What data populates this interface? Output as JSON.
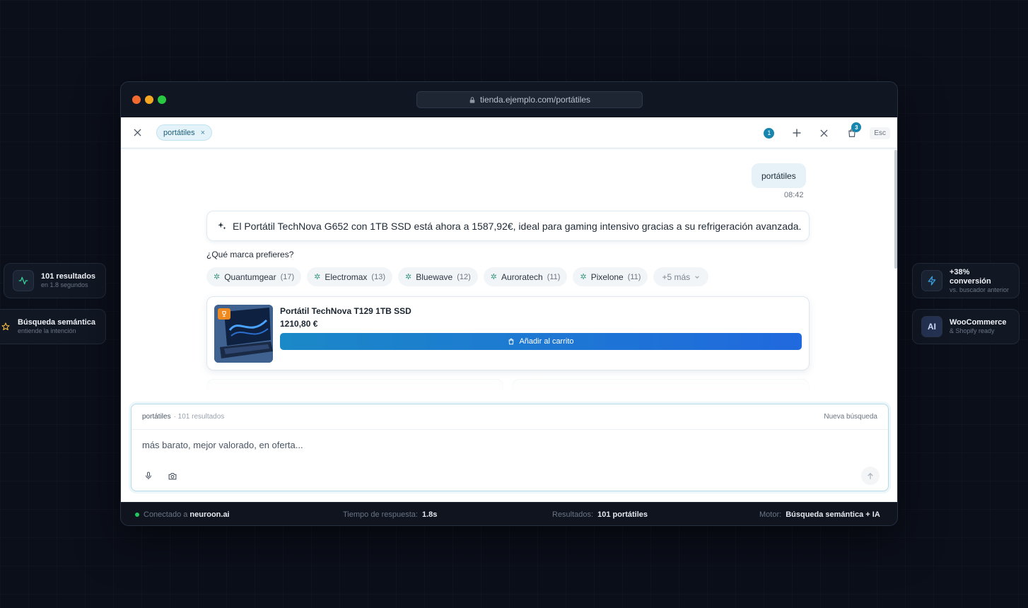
{
  "browser": {
    "url": "tienda.ejemplo.com/portátiles",
    "dot_colors": [
      "#f26a2e",
      "#f5a623",
      "#28c840"
    ]
  },
  "side_cards": {
    "results": {
      "title": "101 resultados",
      "subtitle": "en 1.8 segundos",
      "icon": "activity-icon"
    },
    "semantic": {
      "title": "Búsqueda semántica",
      "subtitle": "entiende la intención",
      "icon": "star-icon"
    },
    "conversion": {
      "title": "+38% conversión",
      "subtitle": "vs. buscador anterior",
      "icon": "bolt-icon"
    },
    "platform": {
      "title": "WooCommerce",
      "subtitle": "& Shopify ready",
      "icon_text": "AI"
    }
  },
  "topbar": {
    "search_chip": "portátiles",
    "chip_remove": "×",
    "conversation_count": "1",
    "cart_count": "3",
    "esc_label": "Esc"
  },
  "chat": {
    "user_message": "portátiles",
    "user_time": "08:42",
    "ai_message": "El Portátil TechNova G652 con 1TB SSD está ahora a 1587,92€, ideal para gaming intensivo gracias a su refrigeración avanzada.",
    "question": "¿Qué marca prefieres?",
    "brands": [
      {
        "name": "Quantumgear",
        "count": "(17)"
      },
      {
        "name": "Electromax",
        "count": "(13)"
      },
      {
        "name": "Bluewave",
        "count": "(12)"
      },
      {
        "name": "Auroratech",
        "count": "(11)"
      },
      {
        "name": "Pixelone",
        "count": "(11)"
      }
    ],
    "more_brands": "+5 más",
    "product": {
      "name": "Portátil TechNova T129 1TB SSD",
      "price": "1210,80 €",
      "add_to_cart": "Añadir al carrito"
    }
  },
  "input": {
    "term": "portátiles",
    "results": "· 101 resultados",
    "new_search": "Nueva búsqueda",
    "placeholder": "más barato, mejor valorado, en oferta..."
  },
  "statusbar": {
    "connected_label": "Conectado a",
    "connected_value": "neuroon.ai",
    "response_label": "Tiempo de respuesta:",
    "response_value": "1.8s",
    "results_label": "Resultados:",
    "results_value": "101 portátiles",
    "engine_label": "Motor:",
    "engine_value": "Búsqueda semántica + IA"
  },
  "colors": {
    "accent": "#1785ae",
    "button_start": "#1b88c7",
    "button_end": "#2069de",
    "status_green": "#22c55e"
  }
}
